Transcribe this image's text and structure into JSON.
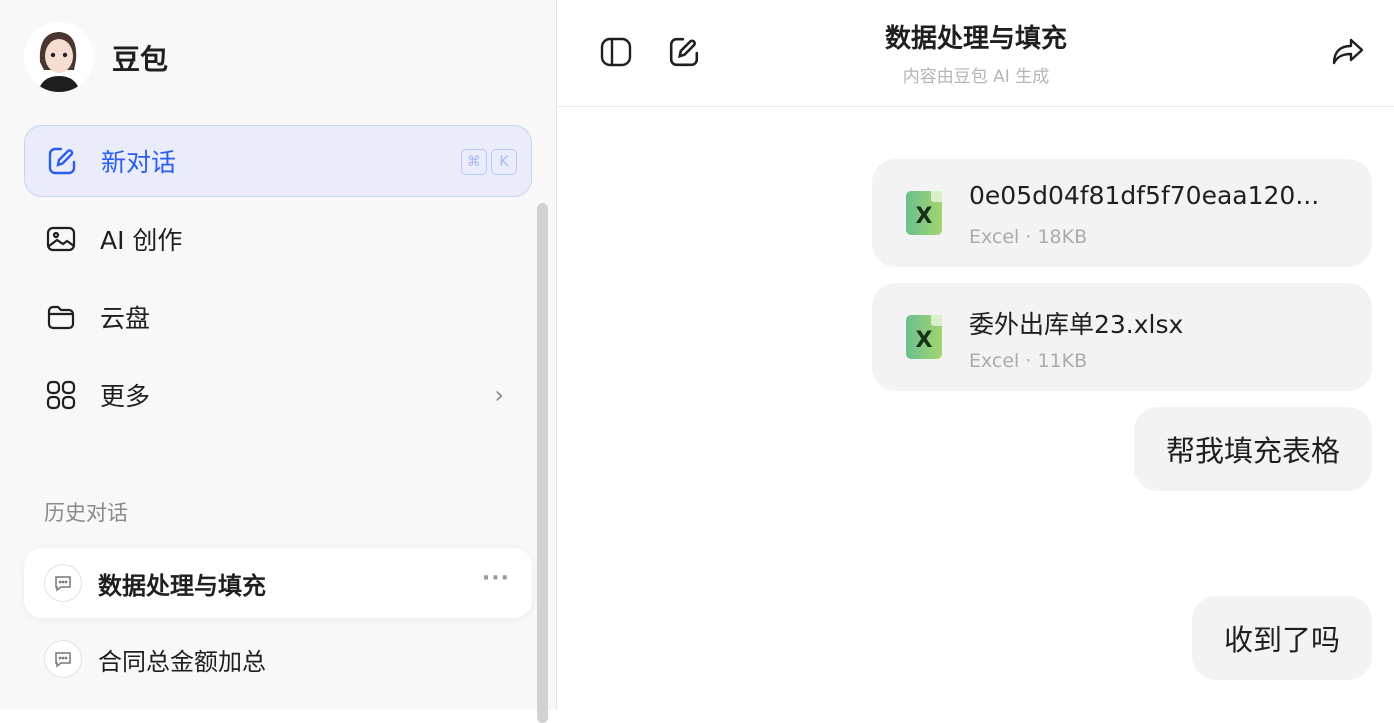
{
  "sidebar": {
    "brand": "豆包",
    "nav": [
      {
        "label": "新对话",
        "shortcut": [
          "⌘",
          "K"
        ]
      },
      {
        "label": "AI 创作"
      },
      {
        "label": "云盘"
      },
      {
        "label": "更多"
      }
    ],
    "history_title": "历史对话",
    "history": [
      {
        "label": "数据处理与填充",
        "more": "···"
      },
      {
        "label": "合同总金额加总"
      }
    ]
  },
  "header": {
    "title": "数据处理与填充",
    "subtitle": "内容由豆包 AI 生成"
  },
  "messages": {
    "files": [
      {
        "name": "0e05d04f81df5f70eaa120...",
        "meta": "Excel · 18KB",
        "icon": "X"
      },
      {
        "name": "委外出库单23.xlsx",
        "meta": "Excel · 11KB",
        "icon": "X"
      }
    ],
    "texts": [
      "帮我填充表格",
      "收到了吗"
    ]
  },
  "colors": {
    "accent": "#2a5ef0",
    "sidebar_bg": "#f8f8f8",
    "bubble_bg": "#f3f3f3"
  }
}
